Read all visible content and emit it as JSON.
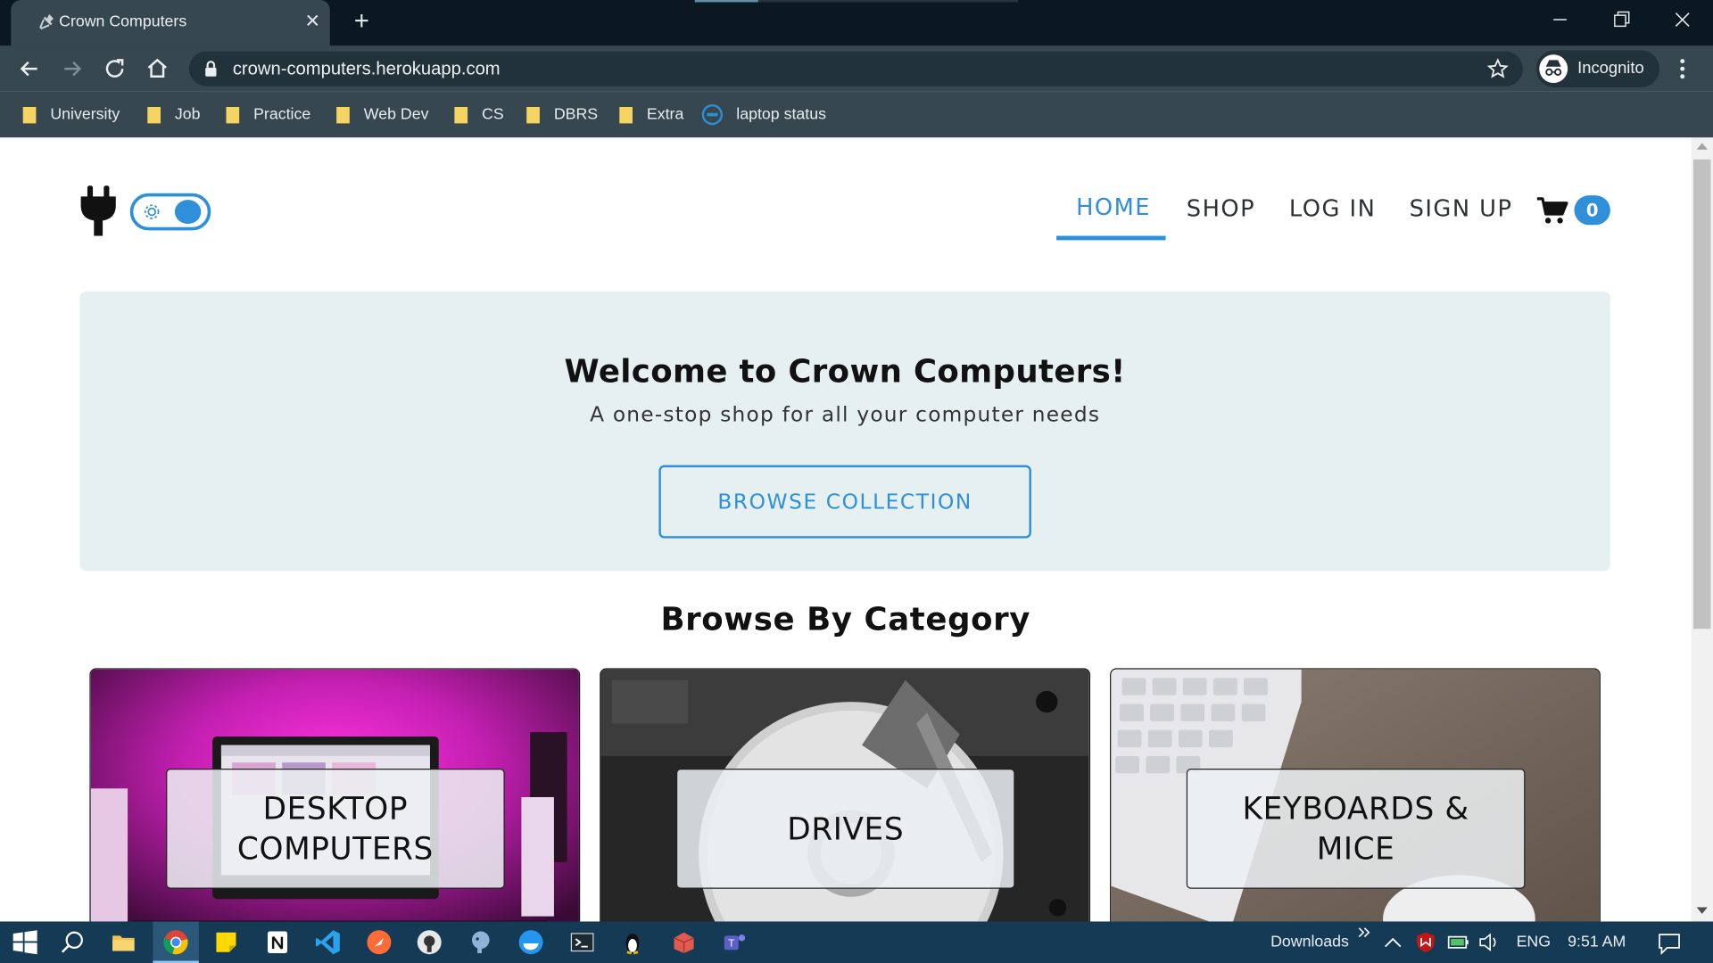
{
  "browser": {
    "tab_title": "Crown Computers",
    "tab_close": "✕",
    "new_tab": "+",
    "url": "crown-computers.herokuapp.com",
    "profile_label": "Incognito",
    "bookmarks": [
      {
        "label": "University",
        "icon": "folder-icon"
      },
      {
        "label": "Job",
        "icon": "folder-icon"
      },
      {
        "label": "Practice",
        "icon": "folder-icon"
      },
      {
        "label": "Web Dev",
        "icon": "folder-icon"
      },
      {
        "label": "CS",
        "icon": "folder-icon"
      },
      {
        "label": "DBRS",
        "icon": "folder-icon"
      },
      {
        "label": "Extra",
        "icon": "folder-icon"
      },
      {
        "label": "laptop status",
        "icon": "dell-icon"
      }
    ]
  },
  "site": {
    "nav": {
      "home": "HOME",
      "shop": "SHOP",
      "login": "LOG IN",
      "signup": "SIGN UP",
      "cart_count": "0",
      "active": "HOME"
    },
    "hero": {
      "title": "Welcome to Crown Computers!",
      "subtitle": "A one-stop shop for all your computer needs",
      "button": "BROWSE COLLECTION"
    },
    "section_title": "Browse By Category",
    "categories": [
      {
        "label": "DESKTOP COMPUTERS",
        "image": "pink-lit-desktop-setup"
      },
      {
        "label": "DRIVES",
        "image": "open-hard-drive-bw"
      },
      {
        "label": "KEYBOARDS & MICE",
        "image": "white-keyboard-on-wood"
      }
    ]
  },
  "taskbar": {
    "downloads_label": "Downloads",
    "language": "ENG",
    "time": "9:51 AM"
  },
  "colors": {
    "accent": "#2f8fd8",
    "hero_bg": "#e6f0f0",
    "chrome_dark": "#36474f",
    "taskbar": "#143a55"
  }
}
